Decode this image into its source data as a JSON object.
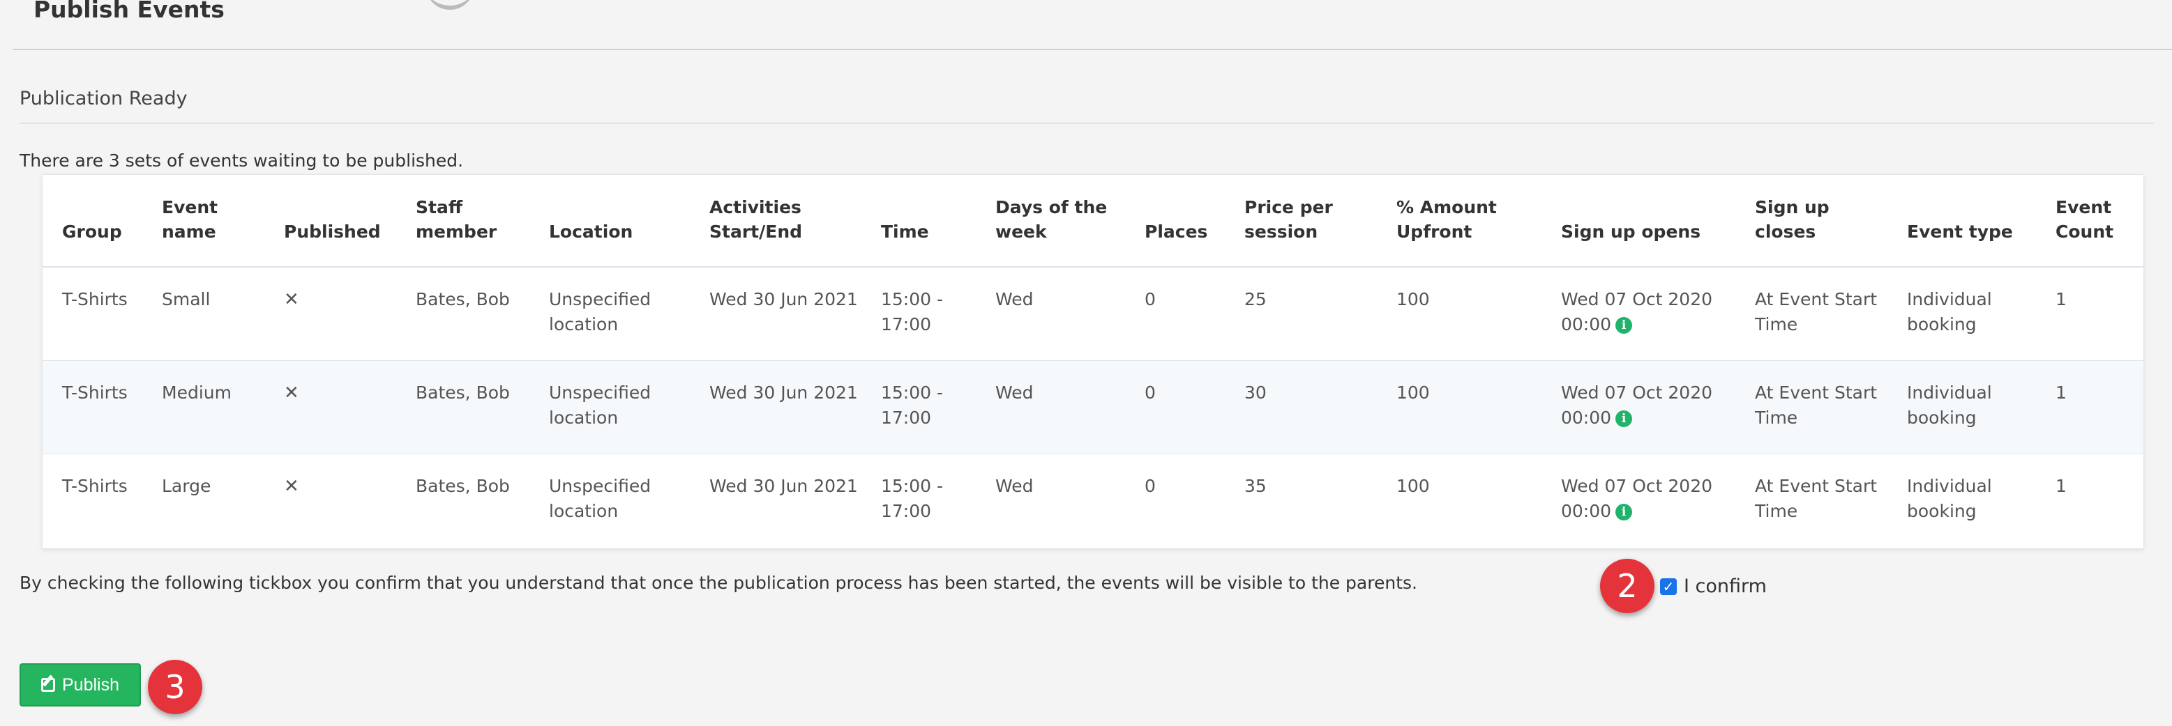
{
  "header": {
    "title": "Publish Events"
  },
  "section": {
    "title": "Publication Ready",
    "waiting_text": "There are 3 sets of events waiting to be published."
  },
  "table": {
    "columns": [
      "Group",
      "Event name",
      "Published",
      "Staff member",
      "Location",
      "Activities Start/End",
      "Time",
      "Days of the week",
      "Places",
      "Price per session",
      "% Amount Upfront",
      "Sign up opens",
      "Sign up closes",
      "Event type",
      "Event Count"
    ],
    "rows": [
      {
        "group": "T-Shirts",
        "event_name": "Small",
        "published": "✕",
        "staff": "Bates, Bob",
        "location": "Unspecified location",
        "activities": "Wed 30 Jun 2021",
        "time": "15:00 - 17:00",
        "days": "Wed",
        "places": "0",
        "price": "25",
        "upfront": "100",
        "signup_opens": "Wed 07 Oct 2020 00:00",
        "signup_closes": "At Event Start Time",
        "event_type": "Individual booking",
        "event_count": "1"
      },
      {
        "group": "T-Shirts",
        "event_name": "Medium",
        "published": "✕",
        "staff": "Bates, Bob",
        "location": "Unspecified location",
        "activities": "Wed 30 Jun 2021",
        "time": "15:00 - 17:00",
        "days": "Wed",
        "places": "0",
        "price": "30",
        "upfront": "100",
        "signup_opens": "Wed 07 Oct 2020 00:00",
        "signup_closes": "At Event Start Time",
        "event_type": "Individual booking",
        "event_count": "1"
      },
      {
        "group": "T-Shirts",
        "event_name": "Large",
        "published": "✕",
        "staff": "Bates, Bob",
        "location": "Unspecified location",
        "activities": "Wed 30 Jun 2021",
        "time": "15:00 - 17:00",
        "days": "Wed",
        "places": "0",
        "price": "35",
        "upfront": "100",
        "signup_opens": "Wed 07 Oct 2020 00:00",
        "signup_closes": "At Event Start Time",
        "event_type": "Individual booking",
        "event_count": "1"
      }
    ],
    "info_icon": "info-icon"
  },
  "confirm": {
    "text": "By checking the following tickbox you confirm that you understand that once the publication process has been started, the events will be visible to the parents.",
    "label": "I confirm",
    "checked": true
  },
  "publish": {
    "label": "Publish",
    "icon": "edit-icon"
  },
  "markers": {
    "step2": "2",
    "step3": "3"
  },
  "colors": {
    "publish_button": "#26b55f",
    "marker": "#e5333b",
    "info_dot": "#21b36b",
    "checkbox": "#1a73e8"
  }
}
